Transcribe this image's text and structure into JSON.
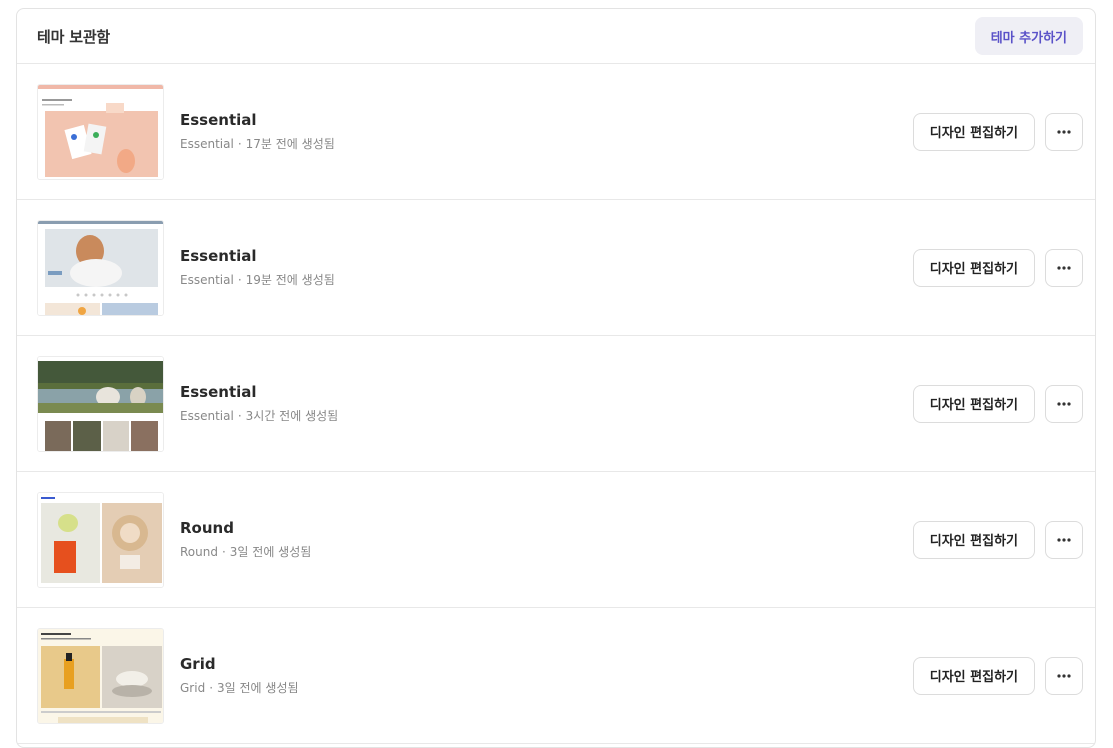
{
  "header": {
    "title": "테마 보관함",
    "add_label": "테마 추가하기"
  },
  "colors": {
    "accent": "#5a52c8",
    "add_button_bg": "#efeff5",
    "border": "#e3e3e3"
  },
  "themes": [
    {
      "name": "Essential",
      "base": "Essential",
      "created": "17분 전에 생성됨",
      "edit_label": "디자인 편집하기",
      "thumb": "peach-product"
    },
    {
      "name": "Essential",
      "base": "Essential",
      "created": "19분 전에 생성됨",
      "edit_label": "디자인 편집하기",
      "thumb": "woman-portrait"
    },
    {
      "name": "Essential",
      "base": "Essential",
      "created": "3시간 전에 생성됨",
      "edit_label": "디자인 편집하기",
      "thumb": "picnic-scene"
    },
    {
      "name": "Round",
      "base": "Round",
      "created": "3일 전에 생성됨",
      "edit_label": "디자인 편집하기",
      "thumb": "swimwear"
    },
    {
      "name": "Grid",
      "base": "Grid",
      "created": "3일 전에 생성됨",
      "edit_label": "디자인 편집하기",
      "thumb": "cosmetics"
    }
  ],
  "separator": "·",
  "more_icon": "ellipsis-icon"
}
